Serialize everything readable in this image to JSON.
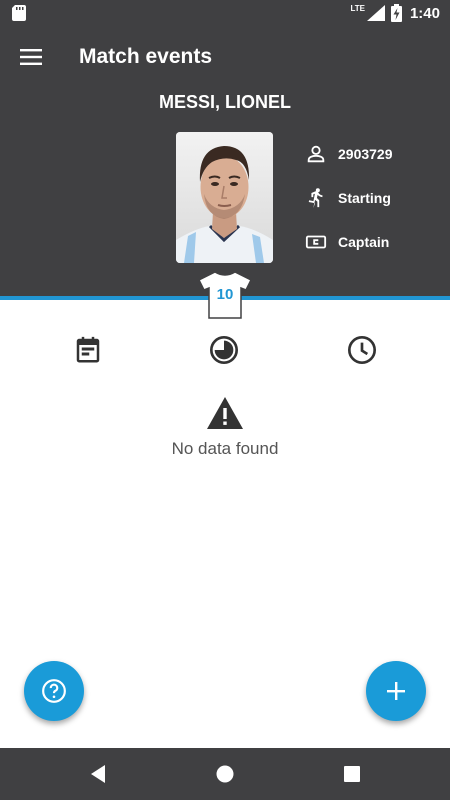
{
  "status_bar": {
    "network": "LTE",
    "time": "1:40"
  },
  "header": {
    "title": "Match events",
    "player_name": "MESSI, LIONEL",
    "player_id": "2903729",
    "lineup_status": "Starting",
    "role": "Captain",
    "shirt_number": "10"
  },
  "tabs": [
    {
      "icon": "event-card-icon"
    },
    {
      "icon": "pie-timer-icon"
    },
    {
      "icon": "clock-icon"
    }
  ],
  "empty_state": {
    "icon": "warning-icon",
    "text": "No data found"
  },
  "fabs": {
    "help_icon": "help-icon",
    "add_icon": "plus-icon"
  },
  "colors": {
    "header_bg": "#404042",
    "accent": "#2196d3",
    "fab": "#1a9bd8"
  }
}
